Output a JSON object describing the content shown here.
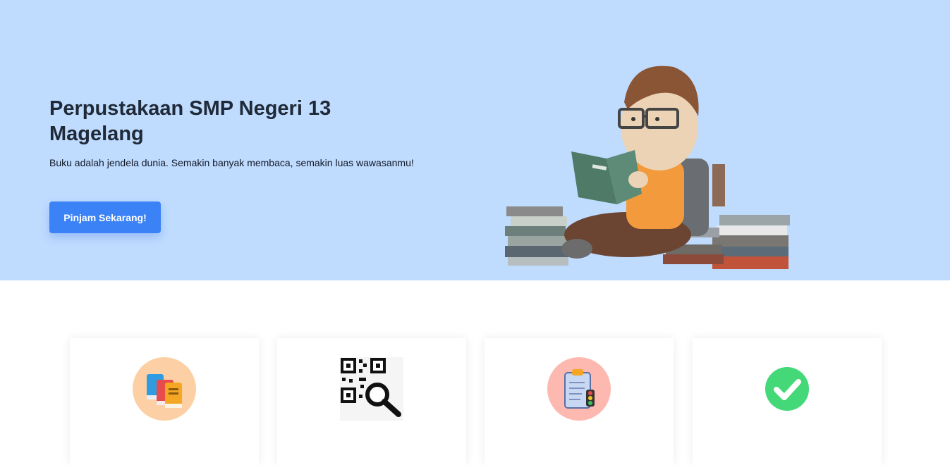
{
  "hero": {
    "title": "Perpustakaan SMP Negeri 13 Magelang",
    "subtitle": "Buku adalah jendela dunia. Semakin banyak membaca, semakin luas wawasanmu!",
    "cta_label": "Pinjam Sekarang!"
  },
  "features": [
    {
      "icon": "books-icon",
      "bg": "#fcd0a4"
    },
    {
      "icon": "qr-search-icon",
      "bg": "#f5f5f5"
    },
    {
      "icon": "clipboard-icon",
      "bg": "#fdb8b0"
    },
    {
      "icon": "check-icon",
      "bg": "#ffffff"
    }
  ],
  "colors": {
    "hero_bg": "#bfdbfe",
    "accent": "#3b82f6"
  }
}
